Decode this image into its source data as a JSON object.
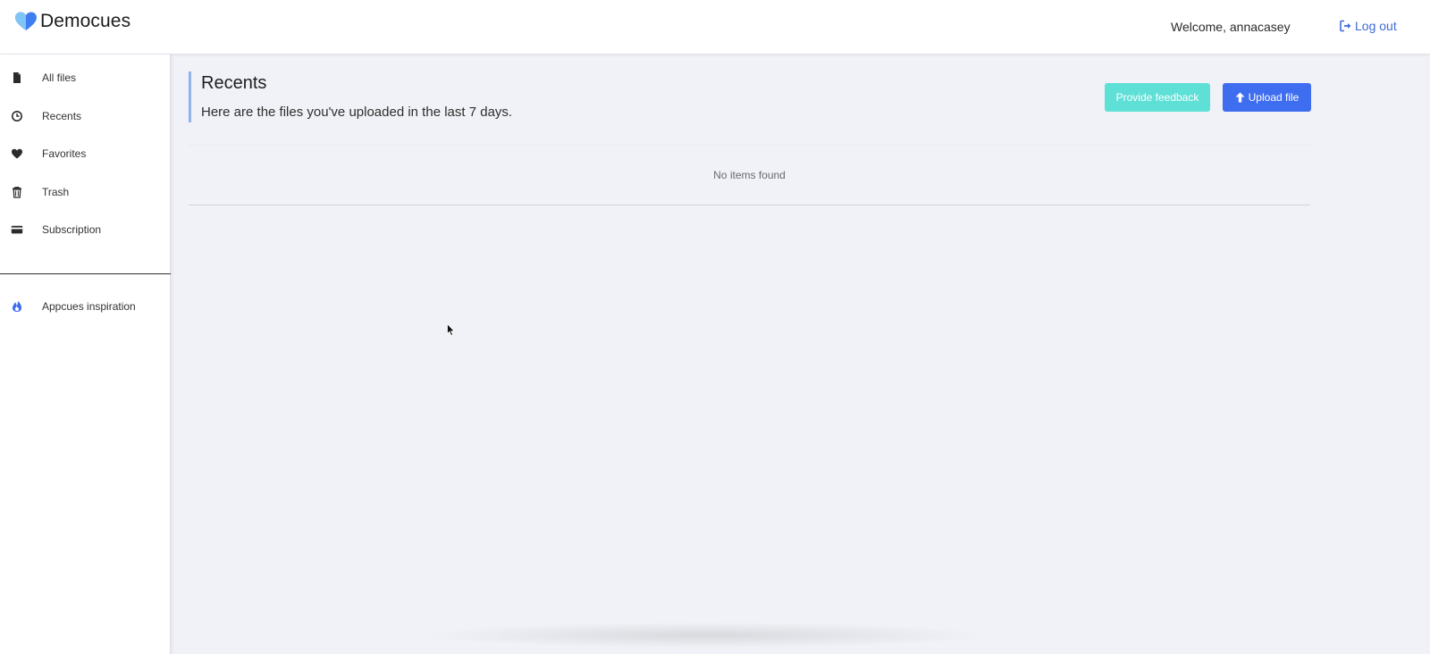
{
  "app": {
    "brand_name": "Democues",
    "brand_color": "#3f6df0"
  },
  "header": {
    "welcome_text": "Welcome, annacasey",
    "logout_label": "Log out",
    "logout_icon": "sign-out-icon"
  },
  "sidebar": {
    "items": [
      {
        "label": "All files",
        "icon": "file-icon"
      },
      {
        "label": "Recents",
        "icon": "clock-icon"
      },
      {
        "label": "Favorites",
        "icon": "heart-icon"
      },
      {
        "label": "Trash",
        "icon": "trash-icon"
      },
      {
        "label": "Subscription",
        "icon": "credit-card-icon"
      }
    ],
    "extra_items": [
      {
        "label": "Appcues inspiration",
        "icon": "fire-icon"
      }
    ]
  },
  "main": {
    "title": "Recents",
    "subtitle": "Here are the files you've uploaded in the last 7 days.",
    "feedback_label": "Provide feedback",
    "upload_label": "Upload file",
    "upload_icon": "arrow-up-icon",
    "empty_text": "No items found"
  },
  "colors": {
    "accent": "#3f6df0",
    "feedback": "#5fe0d6",
    "link": "#3f6ad8",
    "background": "#f1f2f7"
  }
}
